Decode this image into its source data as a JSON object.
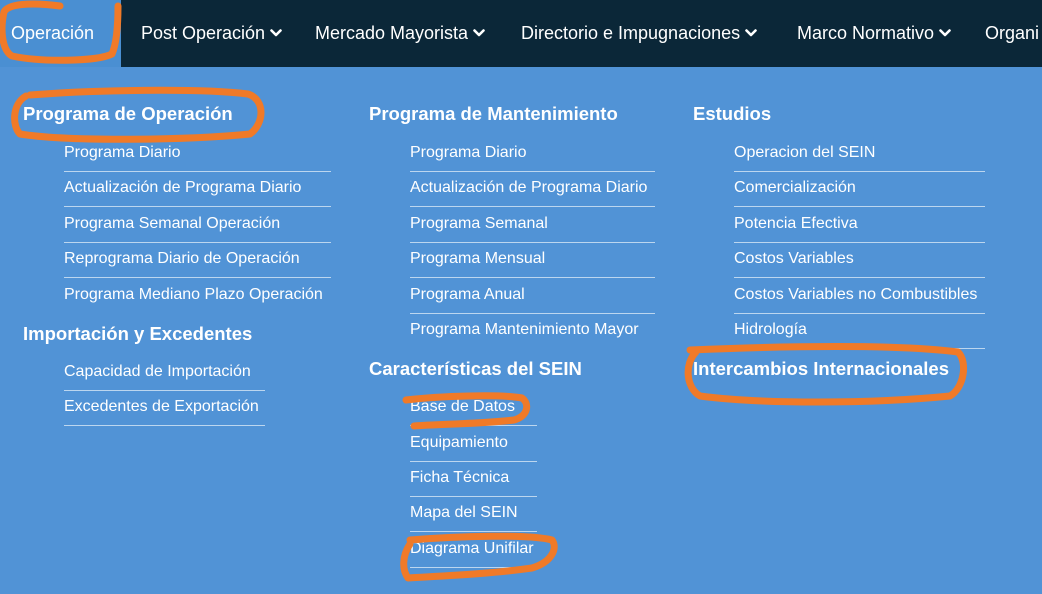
{
  "nav": {
    "items": [
      {
        "label": "Operación",
        "active": true
      },
      {
        "label": "Post Operación",
        "has_dropdown": true
      },
      {
        "label": "Mercado Mayorista",
        "has_dropdown": true
      },
      {
        "label": "Directorio e Impugnaciones",
        "has_dropdown": true
      },
      {
        "label": "Marco Normativo",
        "has_dropdown": true
      },
      {
        "label": "Organi"
      }
    ],
    "dropdown_icon": "chevron-down-icon"
  },
  "menu": {
    "col1": {
      "programa_operacion": {
        "heading": "Programa de Operación",
        "links": [
          "Programa Diario",
          "Actualización de Programa Diario",
          "Programa Semanal Operación",
          "Reprograma Diario de Operación",
          "Programa Mediano Plazo Operación"
        ]
      },
      "importacion": {
        "heading": "Importación y Excedentes",
        "links": [
          "Capacidad de Importación",
          "Excedentes de Exportación"
        ]
      }
    },
    "col2": {
      "mantenimiento": {
        "heading": "Programa de Mantenimiento",
        "links": [
          "Programa Diario",
          "Actualización de Programa Diario",
          "Programa Semanal",
          "Programa Mensual",
          "Programa Anual",
          "Programa Mantenimiento Mayor"
        ]
      },
      "caracteristicas": {
        "heading": "Características del SEIN",
        "links": [
          "Base de Datos",
          "Equipamiento",
          "Ficha Técnica",
          "Mapa del SEIN",
          "Diagrama Unifilar"
        ]
      }
    },
    "col3": {
      "estudios": {
        "heading": "Estudios",
        "links": [
          "Operacion del SEIN",
          "Comercialización",
          "Potencia Efectiva",
          "Costos Variables",
          "Costos Variables no Combustibles",
          "Hidrología"
        ]
      },
      "intercambios": {
        "heading": "Intercambios Internacionales"
      }
    }
  },
  "colors": {
    "nav_bg": "#0b2738",
    "menu_bg": "#5193d6",
    "active_tab": "#4a8fd2",
    "annotation": "#f07a28"
  }
}
